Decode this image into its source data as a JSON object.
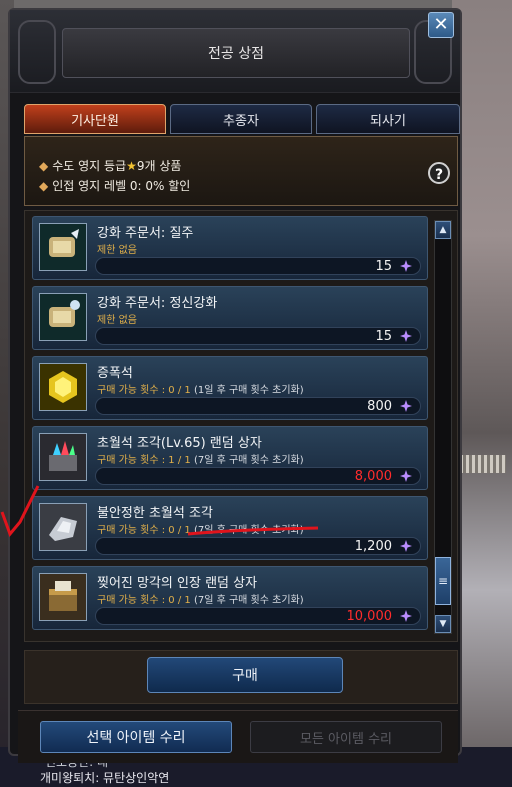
{
  "window": {
    "title": "전공 상점",
    "close_icon": "close-icon"
  },
  "tabs": [
    {
      "label": "기사단원",
      "active": true
    },
    {
      "label": "추종자",
      "active": false
    },
    {
      "label": "되사기",
      "active": false
    }
  ],
  "info": {
    "line1_prefix": "수도 영지 등급",
    "line1_suffix": "9개 상품",
    "line2": "인접 영지 레벨 0: 0% 할인"
  },
  "items": [
    {
      "name": "강화 주문서: 질주",
      "sub": "제한 없음",
      "note": "",
      "price": "15",
      "price_color": "#f3f3f3",
      "icon": "scroll-icon"
    },
    {
      "name": "강화 주문서: 정신강화",
      "sub": "제한 없음",
      "note": "",
      "price": "15",
      "price_color": "#f3f3f3",
      "icon": "scroll-icon"
    },
    {
      "name": "증폭석",
      "sub": "구매 가능 횟수 : 0 / 1",
      "note": "(1일 후 구매 횟수 초기화)",
      "price": "800",
      "price_color": "#f3f3f3",
      "icon": "gem-icon"
    },
    {
      "name": "초월석 조각(Lv.65) 랜덤 상자",
      "sub": "구매 가능 횟수 : 1 / 1",
      "note": "(7일 후 구매 횟수 초기화)",
      "price": "8,000",
      "price_color": "#ff2c2c",
      "icon": "crystal-box-icon"
    },
    {
      "name": "불안정한 초월석 조각",
      "sub": "구매 가능 횟수 : 0 / 1",
      "note": "(7일 후 구매 횟수 초기화)",
      "price": "1,200",
      "price_color": "#f3f3f3",
      "icon": "stone-icon"
    },
    {
      "name": "찢어진 망각의 인장 랜덤 상자",
      "sub": "구매 가능 횟수 : 0 / 1",
      "note": "(7일 후 구매 횟수 초기화)",
      "price": "10,000",
      "price_color": "#ff2c2c",
      "icon": "chest-icon"
    }
  ],
  "buy_label": "구매",
  "repair_selected_label": "선택 아이템 수리",
  "repair_all_label": "모든 아이템 수리",
  "background": {
    "line1": "전모공단: 대",
    "line2": "개미왕퇴치: 뮤탄상인악연"
  },
  "colors": {
    "accent_red": "#ff2c2c",
    "tab_active": "#c1401c",
    "button_blue": "#224878",
    "gold": "#e2b04a"
  }
}
